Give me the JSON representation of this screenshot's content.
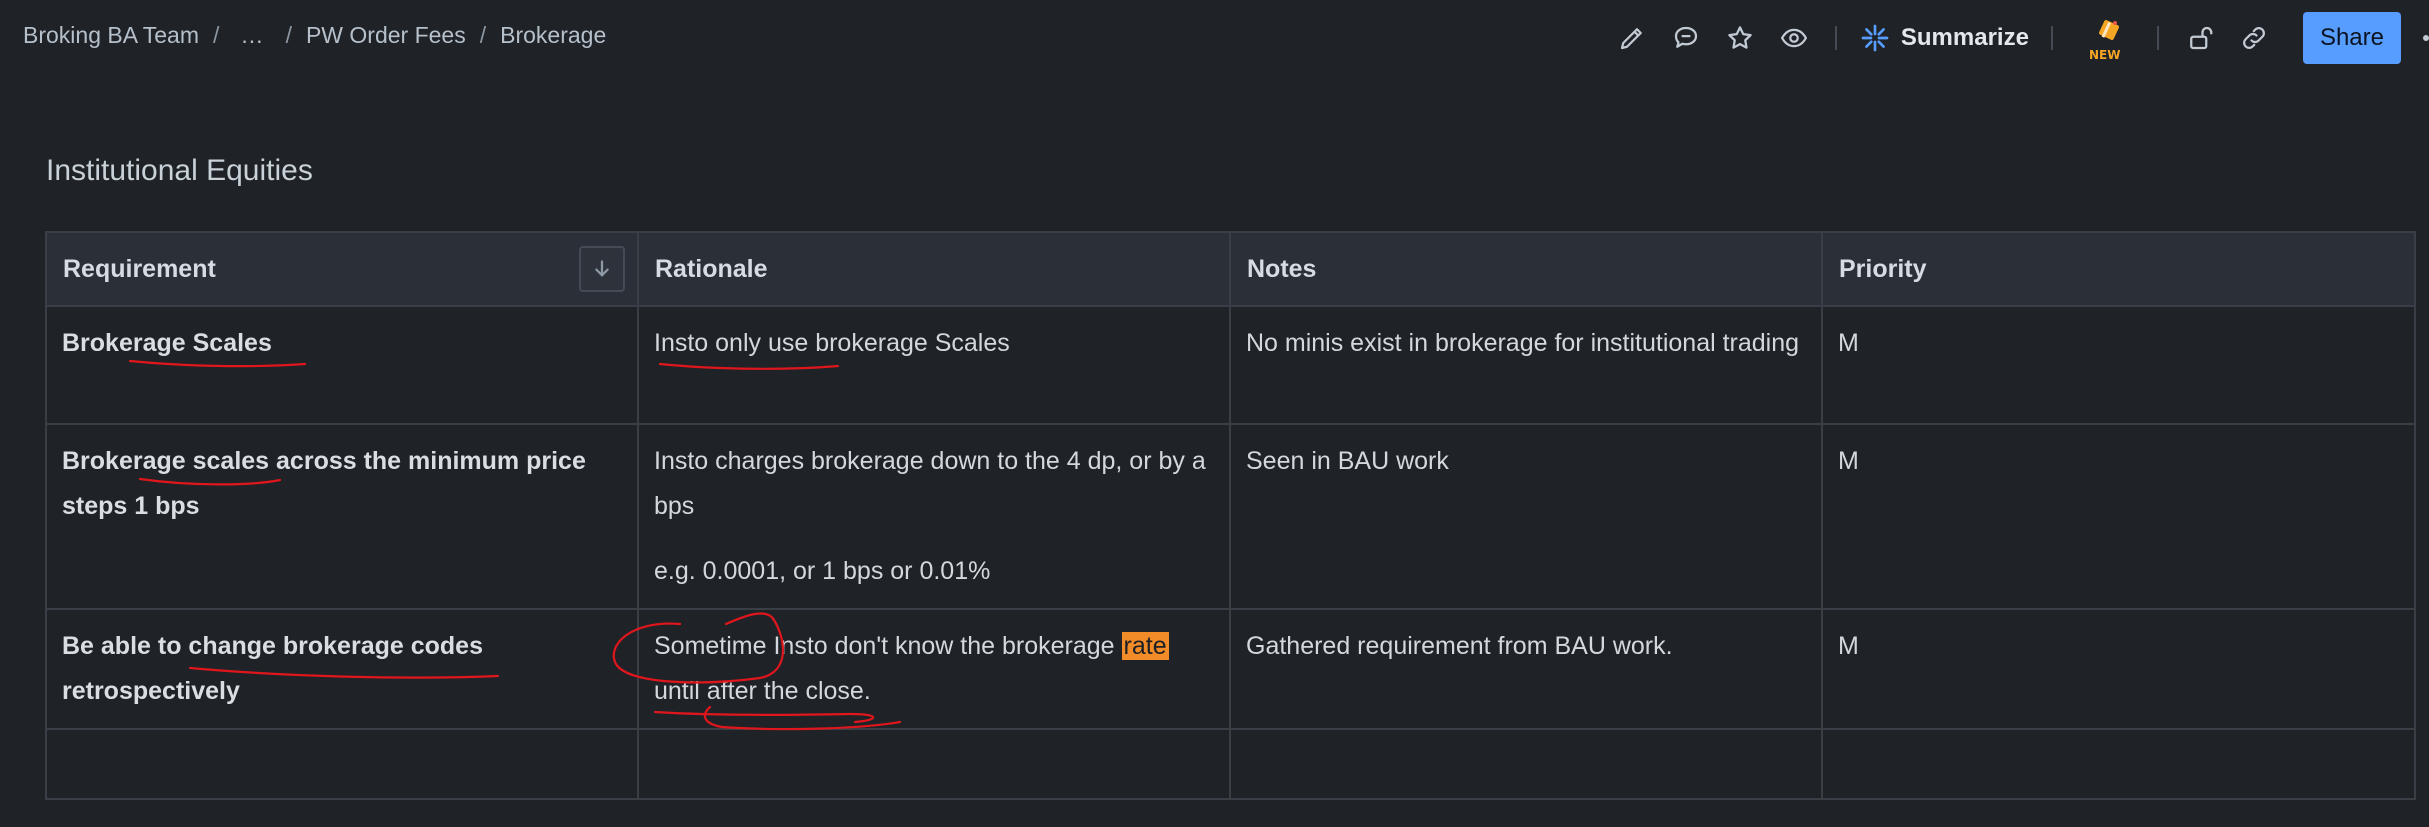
{
  "breadcrumb": {
    "items": [
      "Broking BA Team",
      "...",
      "PW Order Fees",
      "Brokerage"
    ],
    "separator": "/"
  },
  "toolbar": {
    "edit_icon": "pencil-icon",
    "comment_icon": "comment-icon",
    "star_icon": "star-icon",
    "watch_icon": "eye-icon",
    "summarize_label": "Summarize",
    "new_badge": "NEW",
    "restrictions_icon": "unlock-icon",
    "link_icon": "link-icon",
    "share_label": "Share"
  },
  "page": {
    "heading": "Institutional Equities"
  },
  "table": {
    "headers": [
      "Requirement",
      "Rationale",
      "Notes",
      "Priority"
    ],
    "rows": [
      {
        "requirement": "Brokerage Scales",
        "rationale": [
          "Insto only use brokerage Scales"
        ],
        "notes": "No minis exist in brokerage for institutional trading",
        "priority": "M"
      },
      {
        "requirement": "Brokerage scales across the minimum price steps 1 bps",
        "rationale": [
          "Insto charges brokerage down to the 4 dp, or by a bps",
          "e.g. 0.0001, or 1 bps or 0.01%"
        ],
        "notes": "Seen in BAU work",
        "priority": "M"
      },
      {
        "requirement": "Be able to change brokerage codes retrospectively",
        "rationale_before": "Sometime Insto don't know the brokerage ",
        "rationale_highlight": "rate",
        "rationale_after": " until after the close.",
        "notes": "Gathered requirement from BAU work.",
        "priority": "M"
      }
    ]
  },
  "colors": {
    "background": "#1f2227",
    "header_bg": "#2b3038",
    "border": "#3a3f47",
    "share_button": "#579dff",
    "highlight": "#f28c28",
    "annotation_ink": "#e0161d"
  }
}
